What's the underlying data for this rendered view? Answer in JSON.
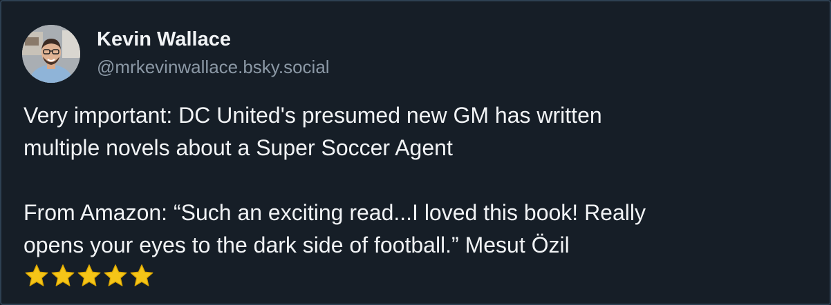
{
  "author": {
    "display_name": "Kevin Wallace",
    "handle": "@mrkevinwallace.bsky.social",
    "avatar_icon": "profile-photo"
  },
  "post": {
    "paragraph_1_line_1": "Very important: DC United's presumed new GM has written",
    "paragraph_1_line_2": "multiple novels about a Super Soccer Agent",
    "paragraph_2_line_1": "From Amazon: “Such an exciting read...I loved this book! Really",
    "paragraph_2_line_2": "opens your eyes to the dark side of football.” Mesut Özil",
    "rating_stars": 5,
    "star_icon": "star-emoji"
  },
  "colors": {
    "background": "#161e27",
    "border": "#2e4052",
    "text_primary": "#f1f3f5",
    "text_secondary": "#8b98a5",
    "star": "#f5c518"
  }
}
